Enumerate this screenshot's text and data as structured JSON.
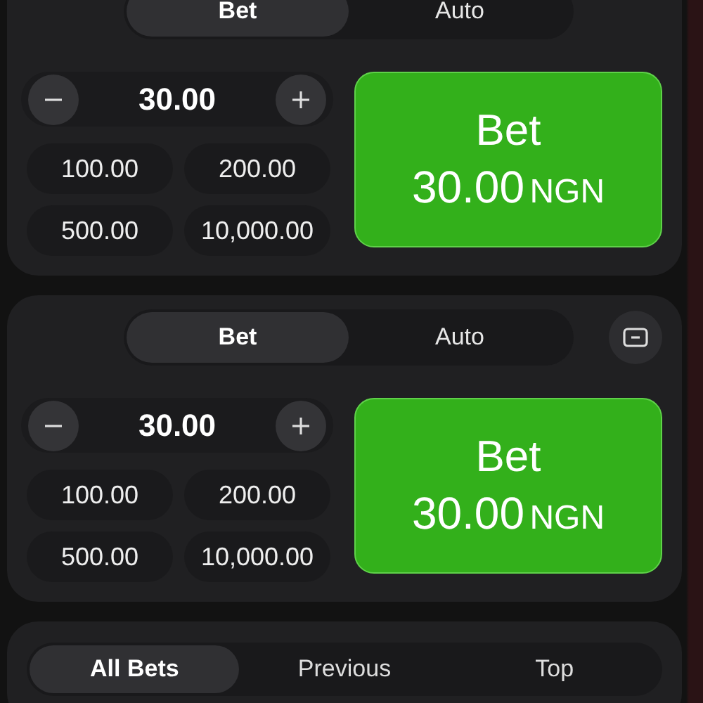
{
  "bet_panels": [
    {
      "tabs": [
        {
          "label": "Bet",
          "selected": true
        },
        {
          "label": "Auto",
          "selected": false
        }
      ],
      "collapse_button": false,
      "stake": "30.00",
      "quick_amounts": [
        "100.00",
        "200.00",
        "500.00",
        "10,000.00"
      ],
      "bet_button": {
        "label": "Bet",
        "amount": "30.00",
        "currency": "NGN"
      }
    },
    {
      "tabs": [
        {
          "label": "Bet",
          "selected": true
        },
        {
          "label": "Auto",
          "selected": false
        }
      ],
      "collapse_button": true,
      "stake": "30.00",
      "quick_amounts": [
        "100.00",
        "200.00",
        "500.00",
        "10,000.00"
      ],
      "bet_button": {
        "label": "Bet",
        "amount": "30.00",
        "currency": "NGN"
      }
    }
  ],
  "bets_tabs": [
    {
      "label": "All Bets",
      "selected": true
    },
    {
      "label": "Previous",
      "selected": false
    },
    {
      "label": "Top",
      "selected": false
    }
  ]
}
